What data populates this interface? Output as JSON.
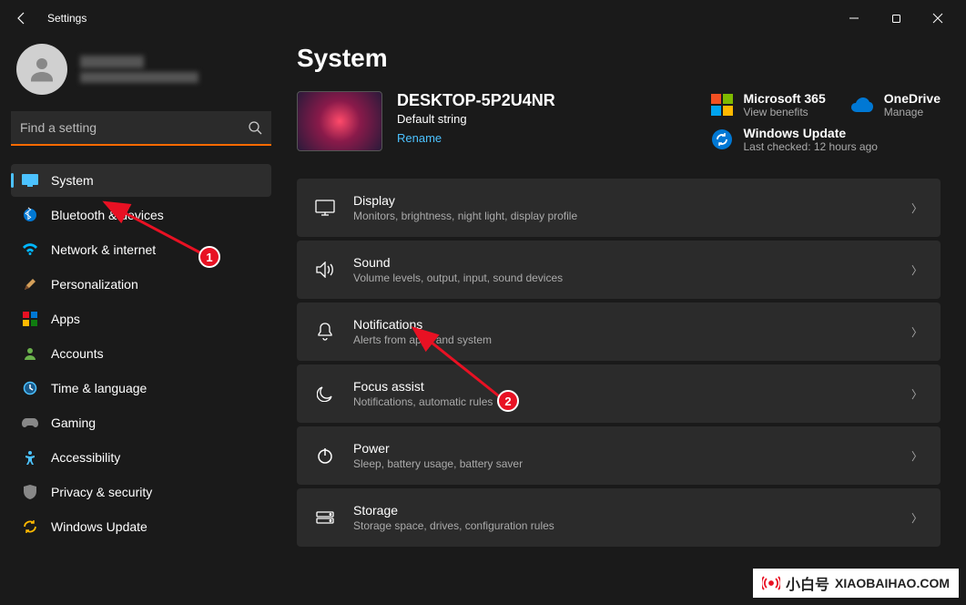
{
  "window": {
    "title": "Settings"
  },
  "search": {
    "placeholder": "Find a setting"
  },
  "nav": {
    "system": "System",
    "bluetooth": "Bluetooth & devices",
    "network": "Network & internet",
    "personalization": "Personalization",
    "apps": "Apps",
    "accounts": "Accounts",
    "time": "Time & language",
    "gaming": "Gaming",
    "accessibility": "Accessibility",
    "privacy": "Privacy & security",
    "update": "Windows Update"
  },
  "page": {
    "title": "System",
    "device": {
      "name": "DESKTOP-5P2U4NR",
      "sub": "Default string",
      "rename": "Rename"
    },
    "tiles": {
      "ms365": {
        "title": "Microsoft 365",
        "sub": "View benefits"
      },
      "onedrive": {
        "title": "OneDrive",
        "sub": "Manage"
      },
      "update": {
        "title": "Windows Update",
        "sub": "Last checked: 12 hours ago"
      }
    },
    "items": {
      "display": {
        "title": "Display",
        "desc": "Monitors, brightness, night light, display profile"
      },
      "sound": {
        "title": "Sound",
        "desc": "Volume levels, output, input, sound devices"
      },
      "notifications": {
        "title": "Notifications",
        "desc": "Alerts from apps and system"
      },
      "focus": {
        "title": "Focus assist",
        "desc": "Notifications, automatic rules"
      },
      "power": {
        "title": "Power",
        "desc": "Sleep, battery usage, battery saver"
      },
      "storage": {
        "title": "Storage",
        "desc": "Storage space, drives, configuration rules"
      }
    }
  },
  "annotations": {
    "badge1": "1",
    "badge2": "2"
  },
  "watermark": {
    "cn": "小白号",
    "en": "XIAOBAIHAO.COM"
  }
}
